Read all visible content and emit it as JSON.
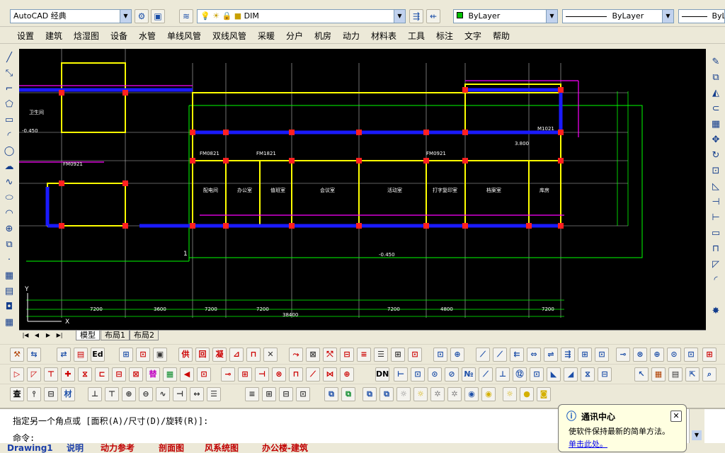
{
  "workspace": {
    "value": "AutoCAD 经典"
  },
  "layer": {
    "value": "DIM"
  },
  "color": {
    "value": "ByLayer"
  },
  "linetype": {
    "value": "ByLayer"
  },
  "lineweight": {
    "value": "ByL"
  },
  "menu": [
    "设置",
    "建筑",
    "焓湿图",
    "设备",
    "水管",
    "单线风管",
    "双线风管",
    "采暖",
    "分户",
    "机房",
    "动力",
    "材料表",
    "工具",
    "标注",
    "文字",
    "帮助"
  ],
  "layout_tabs": [
    "模型",
    "布局1",
    "布局2"
  ],
  "toolbar_labels": {
    "row1": [
      "供",
      "回",
      "凝",
      "Ed"
    ],
    "row2": [
      "替",
      "DN"
    ],
    "row3": [
      "查",
      "材"
    ]
  },
  "drawing_text": {
    "elev_top": "3.800",
    "elev_left": "-0.450",
    "elev_bottom": "-0.450",
    "total_dim": "38400",
    "grid_dims": [
      "7200",
      "3600",
      "7200",
      "7200",
      "7200",
      "4800",
      "7200"
    ],
    "room_labels": [
      "卫生间",
      "配电间",
      "办公室",
      "值班室",
      "会议室",
      "活动室",
      "打字复印室",
      "档案室",
      "库房"
    ],
    "door_tags": [
      "FM0921",
      "FM0821",
      "FM1821",
      "FM0921",
      "M1021"
    ],
    "axis_num": "1"
  },
  "command": {
    "line1": "指定另一个角点或 [面积(A)/尺寸(D)/旋转(R)]:",
    "line2": "命令:"
  },
  "notification": {
    "title": "通讯中心",
    "message": "使软件保持最新的简单方法。",
    "link": "单击此处。"
  },
  "file_tabs": [
    "Drawing1",
    "说明",
    "动力参考",
    "剖面图",
    "风系统图",
    "办公楼-建筑"
  ],
  "colors": {
    "canvas": "#000000",
    "wall": "#ffff00",
    "duct": "#0000ff",
    "dim": "#00ff00",
    "magenta": "#ff00ff",
    "column": "#ff0000"
  }
}
